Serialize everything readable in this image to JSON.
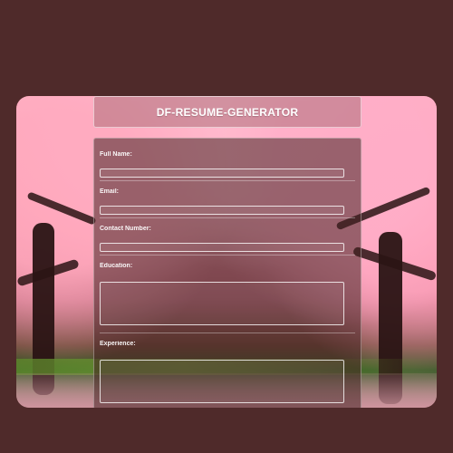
{
  "header": {
    "title": "DF-RESUME-GENERATOR"
  },
  "form": {
    "fields": [
      {
        "label": "Full Name:",
        "type": "input",
        "value": ""
      },
      {
        "label": "Email:",
        "type": "input",
        "value": ""
      },
      {
        "label": "Contact Number:",
        "type": "input",
        "value": ""
      },
      {
        "label": "Education:",
        "type": "textarea",
        "value": ""
      },
      {
        "label": "Experience:",
        "type": "textarea",
        "value": ""
      }
    ]
  },
  "colors": {
    "page_background": "#4f2a2a",
    "panel_background": "#462323",
    "text": "#ffffff",
    "border": "#ffffff"
  }
}
